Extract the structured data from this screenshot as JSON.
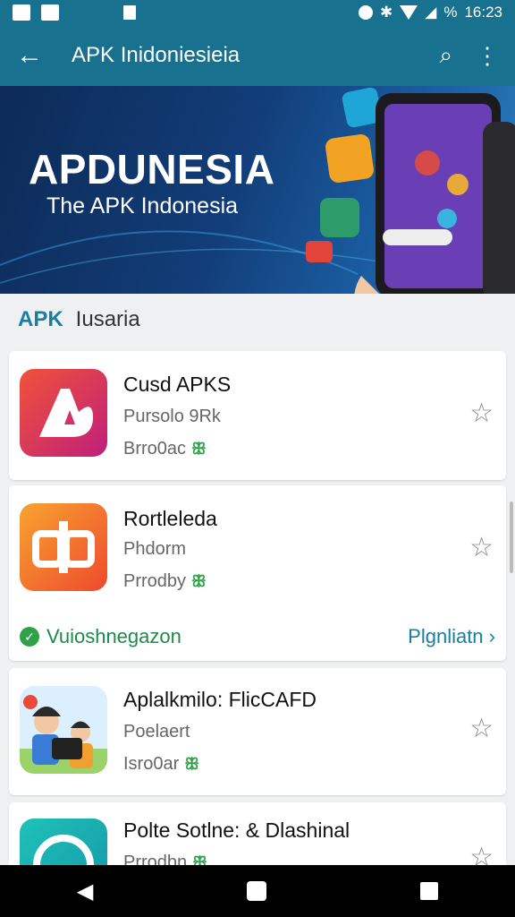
{
  "status": {
    "battery": "%",
    "time": "16:23"
  },
  "app_bar": {
    "title": "APK Inidoniesieia",
    "back_label": "←",
    "search_label": "⌕",
    "menu_label": "⋮"
  },
  "banner": {
    "title": "APDUNESIA",
    "subtitle": "The APK Indonesia"
  },
  "section": {
    "label_primary": "APK",
    "label_secondary": "Iusaria"
  },
  "apps": [
    {
      "name": "Cusd APKS",
      "developer": "Pursolo 9Rk",
      "meta": "Brro0ac",
      "leaf": "ꕥ",
      "star": "☆"
    },
    {
      "name": "Rortleleda",
      "developer": "Phdorm",
      "meta": "Prrodby",
      "leaf": "ꕥ",
      "star": "☆"
    },
    {
      "name": "Aplalkmilo: FlicCAFD",
      "developer": "Poelaert",
      "meta": "Isro0ar",
      "leaf": "ꕥ",
      "star": "☆"
    },
    {
      "name": "Polte Sotlne: & Dlashinal",
      "developer": "",
      "meta": "Prrodbn",
      "leaf": "ꕥ",
      "star": "☆"
    }
  ],
  "verified_row": {
    "text": "Vuioshnegazon",
    "more": "Plgnliatn ›",
    "check": "✓"
  },
  "nav": {
    "back": "◀"
  },
  "colors": {
    "primary": "#17718f",
    "accent": "#157fa6",
    "green": "#2fa14a"
  },
  "icons": [
    "back-arrow-icon",
    "search-icon",
    "more-vert-icon",
    "star-outline-icon",
    "leaf-icon",
    "check-circle-icon"
  ]
}
